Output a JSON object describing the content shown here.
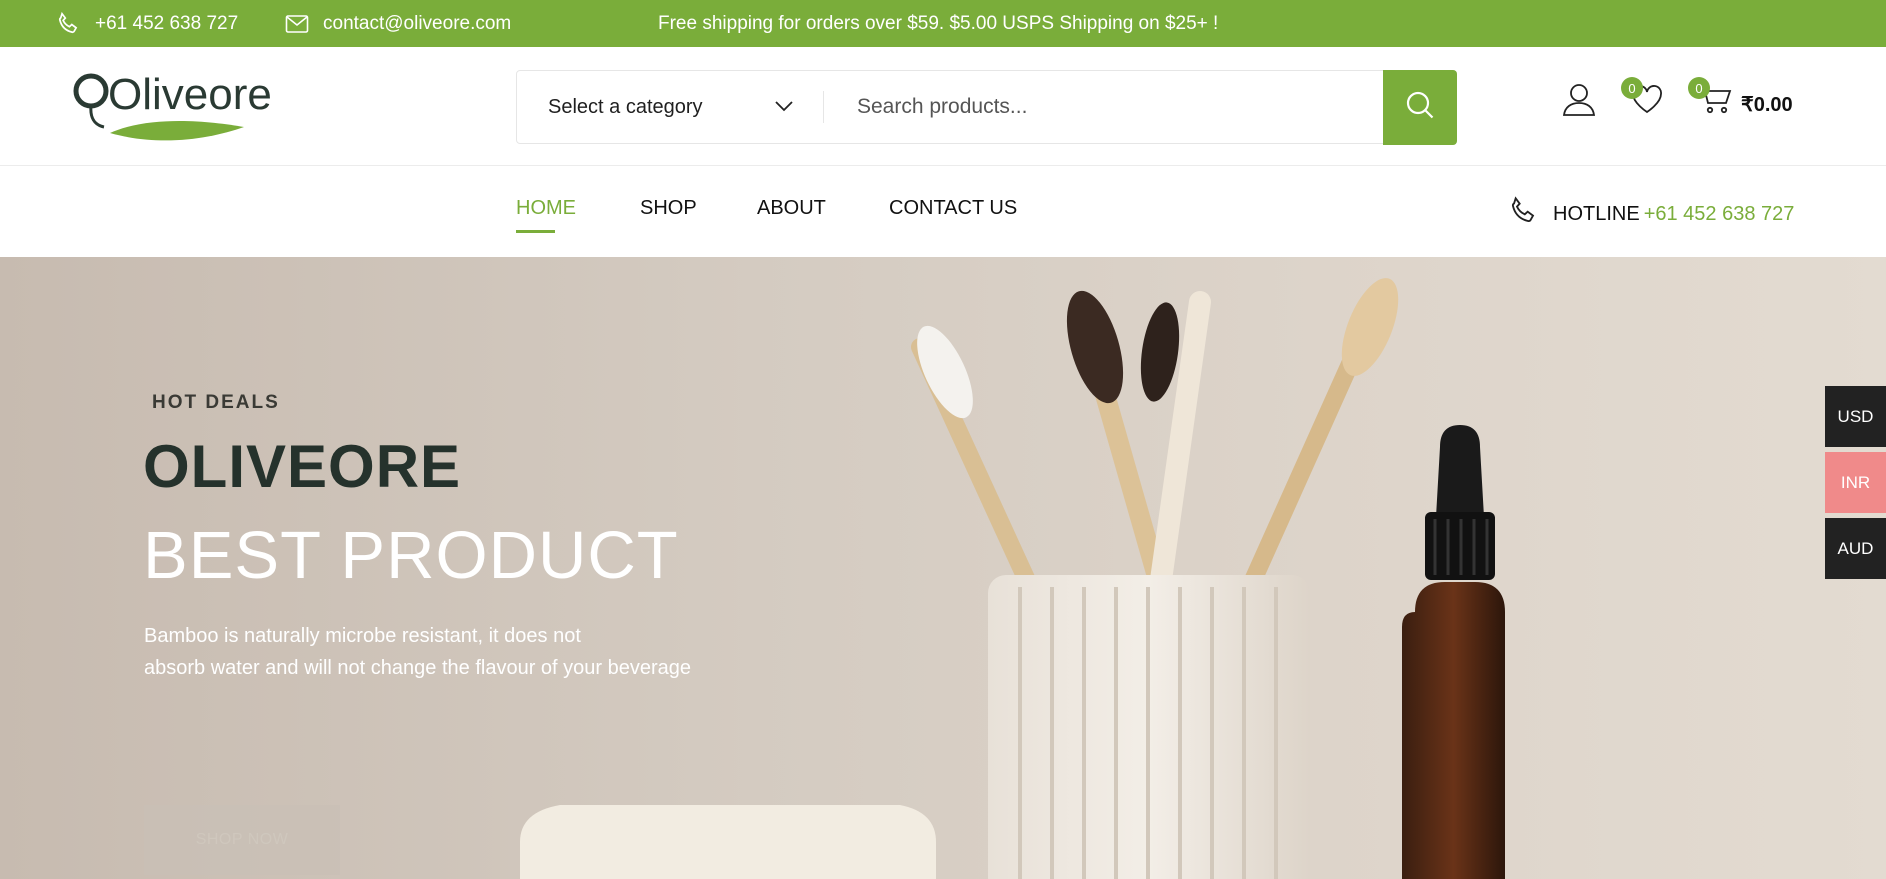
{
  "topbar": {
    "phone": "+61 452 638 727",
    "email": "contact@oliveore.com",
    "promo": "Free shipping for orders over $59. $5.00 USPS Shipping on $25+ !"
  },
  "brand": {
    "logo_text": "Oliveore"
  },
  "search": {
    "category_label": "Select a category",
    "placeholder": "Search products..."
  },
  "header": {
    "wishlist_count": "0",
    "cart_count": "0",
    "cart_total": "₹0.00"
  },
  "nav": {
    "items": [
      {
        "label": "HOME",
        "active": true
      },
      {
        "label": "SHOP"
      },
      {
        "label": "ABOUT"
      },
      {
        "label": "CONTACT US"
      }
    ],
    "hotline_label": "HOTLINE",
    "hotline_number": "+61 452 638 727"
  },
  "hero": {
    "kicker": "HOT DEALS",
    "title_line1": "OLIVEORE",
    "title_line2": "BEST PRODUCT",
    "desc_line1": "Bamboo is naturally microbe resistant, it does not",
    "desc_line2": "absorb water and will not change the flavour of your beverage",
    "button": "SHOP NOW"
  },
  "currency": [
    {
      "code": "USD",
      "color": "#222222"
    },
    {
      "code": "INR",
      "color": "#f08a8a"
    },
    {
      "code": "AUD",
      "color": "#222222"
    }
  ],
  "colors": {
    "accent": "#7aad3a",
    "dark": "#25322c"
  }
}
